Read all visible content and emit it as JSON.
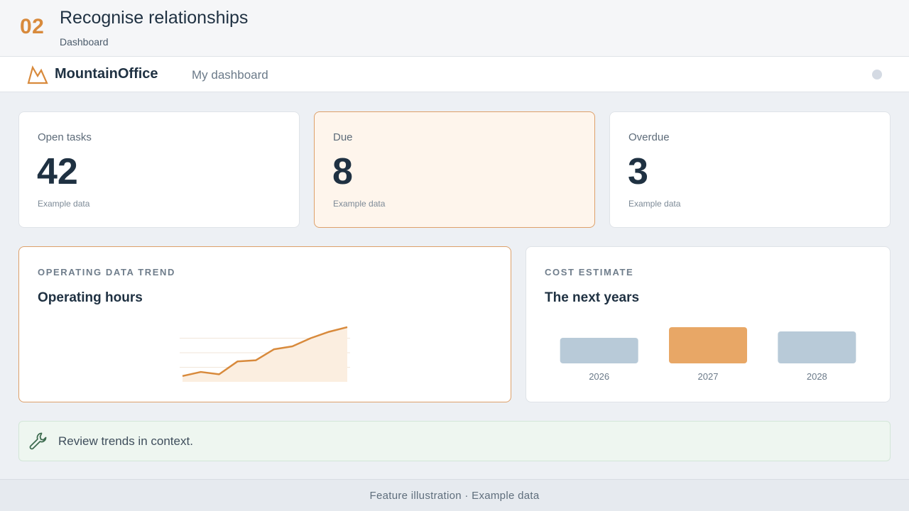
{
  "header": {
    "step": "02",
    "title": "Recognise relationships",
    "subtitle": "Dashboard"
  },
  "app_bar": {
    "brand": "MountainOffice",
    "nav_link": "My dashboard",
    "logo_icon": "mountain-icon"
  },
  "stats": [
    {
      "label": "Open tasks",
      "value": "42",
      "note": "Example data"
    },
    {
      "label": "Due",
      "value": "8",
      "note": "Example data"
    },
    {
      "label": "Overdue",
      "value": "3",
      "note": "Example data"
    }
  ],
  "trend_panel": {
    "eyebrow": "OPERATING DATA TREND",
    "title": "Operating hours"
  },
  "cost_panel": {
    "eyebrow": "COST ESTIMATE",
    "title": "The next years"
  },
  "chart_data": [
    {
      "type": "area",
      "title": "Operating hours",
      "x": [
        1,
        2,
        3,
        4,
        5,
        6,
        7,
        8,
        9,
        10
      ],
      "series": [
        {
          "values": [
            10,
            17,
            13,
            35,
            37,
            56,
            61,
            75,
            86,
            94
          ]
        }
      ],
      "ylim": [
        0,
        100
      ],
      "grid": true,
      "colors": {
        "line": "#d88a3c",
        "fill": "#fbeee0"
      }
    },
    {
      "type": "bar",
      "title": "The next years",
      "categories": [
        "2026",
        "2027",
        "2028"
      ],
      "values": [
        36,
        51,
        45
      ],
      "ylim": [
        0,
        60
      ],
      "colors": [
        "#b8cad8",
        "#e8a766",
        "#b8cad8"
      ]
    }
  ],
  "banner": {
    "text": "Review trends in context.",
    "icon": "wrench-icon"
  },
  "footer": {
    "text": "Feature illustration · Example data"
  },
  "colors": {
    "accent": "#d88a3c",
    "text": "#1f3142",
    "banner_bg": "#eef6f0"
  }
}
